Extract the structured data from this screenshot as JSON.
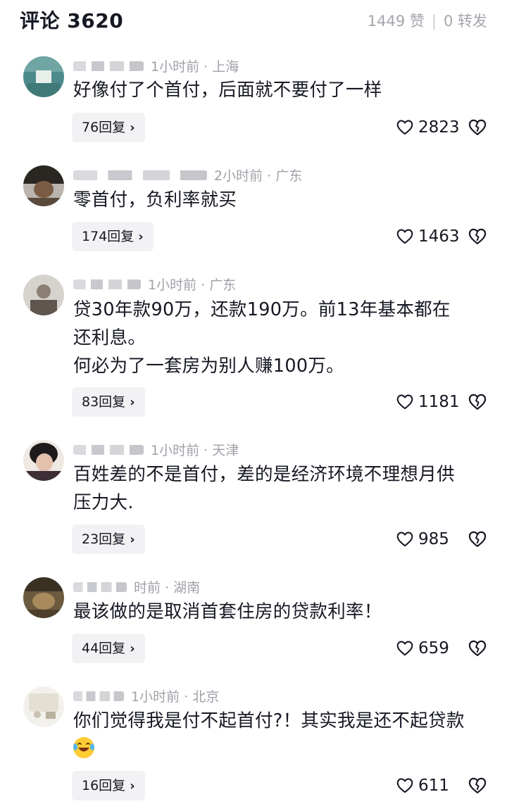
{
  "header": {
    "title": "评论 3620",
    "likes": "1449 赞",
    "divider": "|",
    "shares": "0 转发"
  },
  "colors": {
    "accent_text": "#161823",
    "muted": "#9fa1a8",
    "reply_bg": "#f2f2f4"
  },
  "comments": [
    {
      "time_location": "1小时前 · 上海",
      "lines": [
        "好像付了个首付，后面就不要付了一样"
      ],
      "replies": "76回复",
      "likes": "2823",
      "icons": [
        "heart-outline-icon",
        "broken-heart-icon"
      ]
    },
    {
      "time_location": "2小时前 · 广东",
      "lines": [
        "零首付，负利率就买"
      ],
      "replies": "174回复",
      "likes": "1463",
      "icons": [
        "heart-outline-icon",
        "broken-heart-icon"
      ]
    },
    {
      "time_location": "1小时前 · 广东",
      "lines": [
        "贷30年款90万，还款190万。前13年基本都在",
        "还利息。",
        "何必为了一套房为别人赚100万。"
      ],
      "replies": "83回复",
      "likes": "1181",
      "icons": [
        "heart-outline-icon",
        "broken-heart-icon"
      ]
    },
    {
      "time_location": "1小时前 · 天津",
      "lines": [
        "百姓差的不是首付，差的是经济环境不理想月供",
        "压力大."
      ],
      "replies": "23回复",
      "likes": "985",
      "icons": [
        "heart-outline-icon",
        "broken-heart-icon"
      ]
    },
    {
      "time_location": "时前 · 湖南",
      "lines": [
        "最该做的是取消首套住房的贷款利率！"
      ],
      "replies": "44回复",
      "likes": "659",
      "icons": [
        "heart-outline-icon",
        "broken-heart-icon"
      ]
    },
    {
      "time_location": "1小时前 · 北京",
      "lines": [
        "你们觉得我是付不起首付?！其实我是还不起贷款"
      ],
      "emoji": "laughing-tears-emoji",
      "replies": "16回复",
      "likes": "611",
      "icons": [
        "heart-outline-icon",
        "broken-heart-icon"
      ]
    }
  ]
}
